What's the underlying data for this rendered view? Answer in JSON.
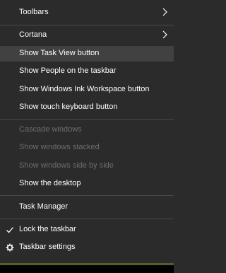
{
  "menu": {
    "items": {
      "toolbars": {
        "label": "Toolbars",
        "icon": "chevron-right-icon"
      },
      "cortana": {
        "label": "Cortana",
        "icon": "chevron-right-icon"
      },
      "task_view": {
        "label": "Show Task View button"
      },
      "people": {
        "label": "Show People on the taskbar"
      },
      "ink": {
        "label": "Show Windows Ink Workspace button"
      },
      "touch_keyboard": {
        "label": "Show touch keyboard button"
      },
      "cascade": {
        "label": "Cascade windows"
      },
      "stacked": {
        "label": "Show windows stacked"
      },
      "side_by_side": {
        "label": "Show windows side by side"
      },
      "desktop": {
        "label": "Show the desktop"
      },
      "task_manager": {
        "label": "Task Manager"
      },
      "lock": {
        "label": "Lock the taskbar",
        "icon": "checkmark-icon"
      },
      "settings": {
        "label": "Taskbar settings",
        "icon": "gear-icon"
      }
    }
  },
  "colors": {
    "menu_bg": "#2b2b2b",
    "hover_bg": "#414141",
    "text": "#ffffff",
    "disabled_text": "#6d6d6d",
    "separator": "#4a4a4a"
  }
}
